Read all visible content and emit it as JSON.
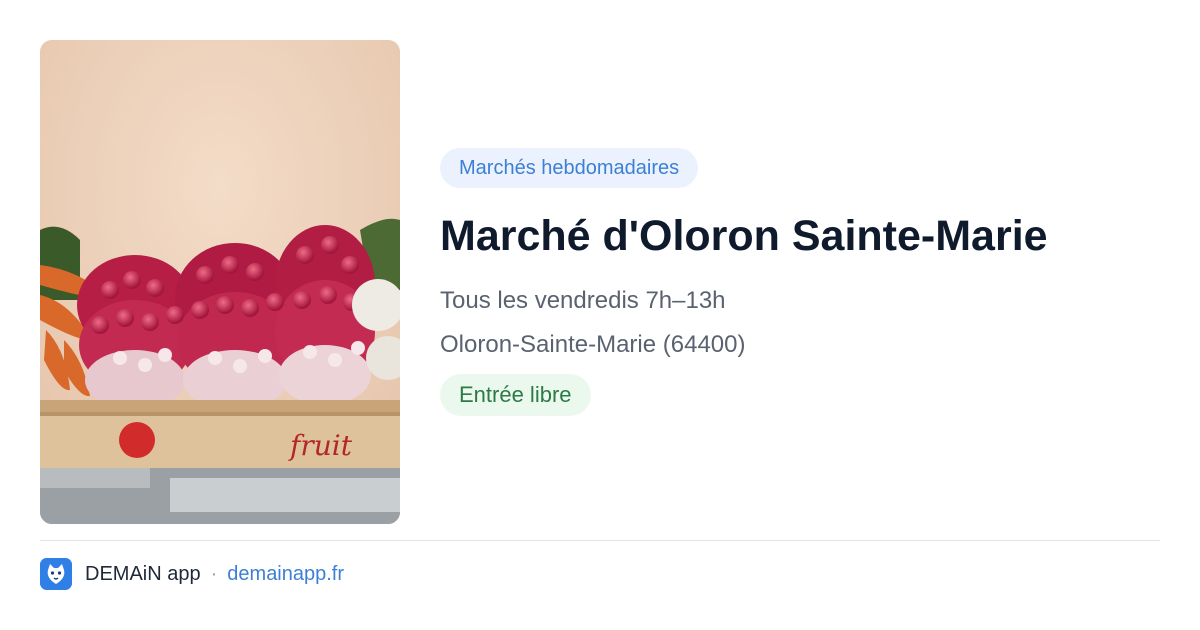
{
  "card": {
    "category": "Marchés hebdomadaires",
    "title": "Marché d'Oloron Sainte-Marie",
    "schedule": "Tous les vendredis 7h–13h",
    "location": "Oloron-Sainte-Marie (64400)",
    "entry": "Entrée libre",
    "image": {
      "alt": "Bottes de radis sur une cagette au marché",
      "crate_text": "fruit"
    }
  },
  "footer": {
    "app_name": "DEMAiN app",
    "separator": "·",
    "url": "demainapp.fr",
    "logo_icon": "demain-logo-icon"
  },
  "colors": {
    "category_bg": "#ebf2fd",
    "category_text": "#3d7fd6",
    "entry_bg": "#ebf8ee",
    "entry_text": "#2d7a46",
    "link": "#3d7fd6",
    "title": "#101a2d"
  }
}
